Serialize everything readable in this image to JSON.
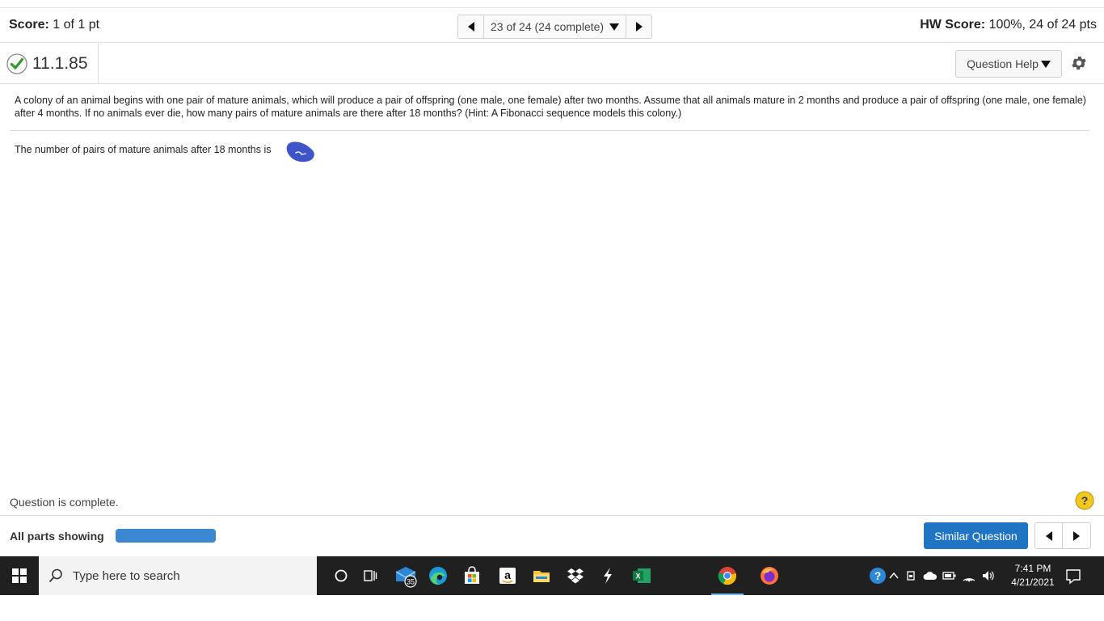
{
  "topbar": {
    "score_label": "Score:",
    "score_value": "1 of 1 pt",
    "nav_position": "23 of 24 (24 complete)",
    "hw_label": "HW Score:",
    "hw_value": "100%, 24 of 24 pts"
  },
  "question": {
    "id": "11.1.85",
    "help_label": "Question Help",
    "text": "A colony of an animal begins with one pair of mature animals, which will produce a pair of offspring (one male, one female) after two months. Assume that all animals mature in 2 months and produce a pair of offspring (one male, one female) after 4 months. If no animals ever die, how many pairs of mature animals are there after 18 months? (Hint: A Fibonacci sequence models this colony.)",
    "answer_prompt": "The number of pairs of mature animals after 18 months is"
  },
  "footer": {
    "status": "Question is complete.",
    "parts_label": "All parts showing",
    "parts_progress": 1.0,
    "similar_label": "Similar Question"
  },
  "taskbar": {
    "search_placeholder": "Type here to search",
    "mail_badge": "35",
    "time": "7:41 PM",
    "date": "4/21/2021"
  },
  "colors": {
    "accent_blue": "#1f74c4",
    "progress_blue": "#3b87d1",
    "check_green": "#2a9d2a",
    "taskbar_bg": "#202020"
  }
}
